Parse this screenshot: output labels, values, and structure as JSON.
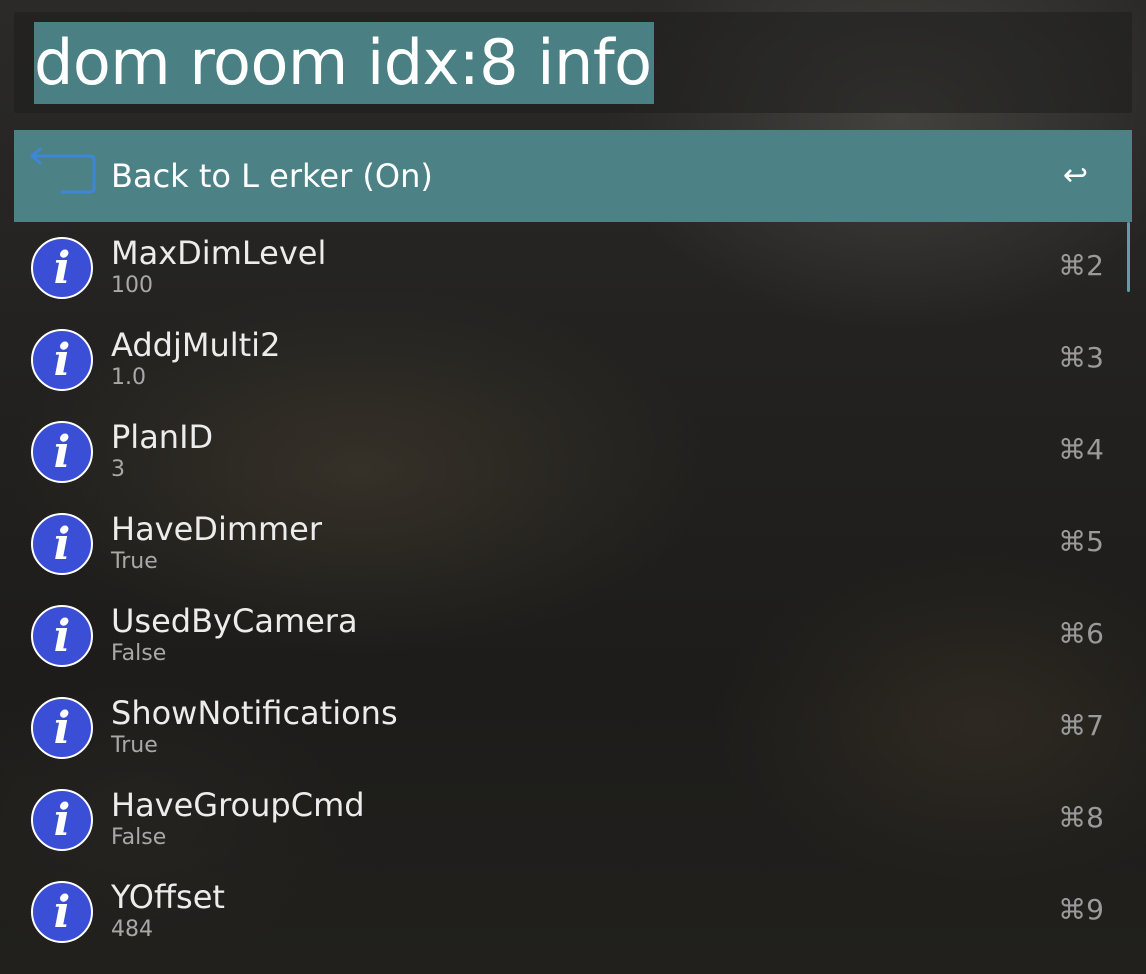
{
  "search": {
    "query": "dom room idx:8 info"
  },
  "results": [
    {
      "title": "Back to L erker (On)",
      "subtitle": "",
      "shortcut": "↩",
      "icon": "back-arrow-icon",
      "selected": true
    },
    {
      "title": "MaxDimLevel",
      "subtitle": "100",
      "shortcut": "⌘2",
      "icon": "info-icon"
    },
    {
      "title": "AddjMulti2",
      "subtitle": "1.0",
      "shortcut": "⌘3",
      "icon": "info-icon"
    },
    {
      "title": "PlanID",
      "subtitle": "3",
      "shortcut": "⌘4",
      "icon": "info-icon"
    },
    {
      "title": "HaveDimmer",
      "subtitle": "True",
      "shortcut": "⌘5",
      "icon": "info-icon"
    },
    {
      "title": "UsedByCamera",
      "subtitle": "False",
      "shortcut": "⌘6",
      "icon": "info-icon"
    },
    {
      "title": "ShowNotifications",
      "subtitle": "True",
      "shortcut": "⌘7",
      "icon": "info-icon"
    },
    {
      "title": "HaveGroupCmd",
      "subtitle": "False",
      "shortcut": "⌘8",
      "icon": "info-icon"
    },
    {
      "title": "YOffset",
      "subtitle": "484",
      "shortcut": "⌘9",
      "icon": "info-icon"
    }
  ],
  "colors": {
    "selection": "#4c8286",
    "query_highlight": "#4a8083",
    "info_icon_blue": "#3a4fd6",
    "back_icon_blue": "#3d86d8"
  }
}
